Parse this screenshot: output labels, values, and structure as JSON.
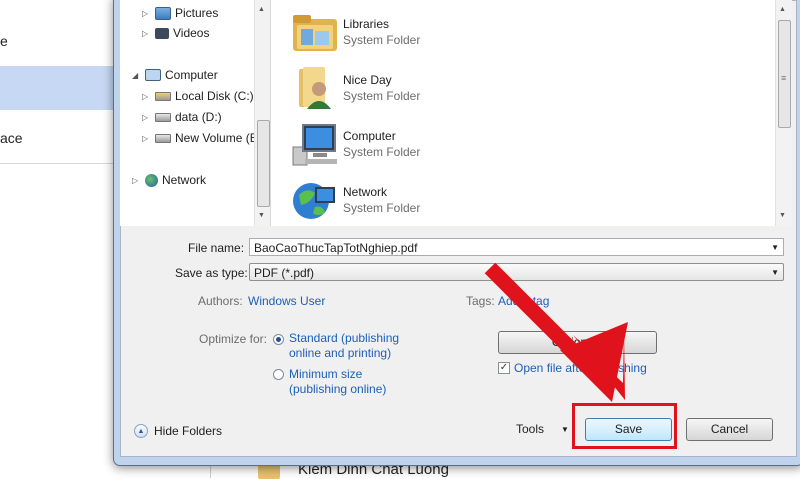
{
  "background": {
    "left_items": [
      "e",
      "ace"
    ],
    "bottom_text": "Kiem Dinh Chat Luong"
  },
  "nav_tree": [
    {
      "label": "Pictures",
      "icon": "pictures-icon",
      "expander": "▷"
    },
    {
      "label": "Videos",
      "icon": "videos-icon",
      "expander": "▷"
    },
    {
      "label": "Computer",
      "icon": "computer-icon",
      "expander": "◢"
    },
    {
      "label": "Local Disk (C:)",
      "icon": "windows-drive-icon",
      "expander": "▷"
    },
    {
      "label": "data (D:)",
      "icon": "drive-icon",
      "expander": "▷"
    },
    {
      "label": "New Volume (E",
      "icon": "drive-icon",
      "expander": "▷"
    },
    {
      "label": "Network",
      "icon": "network-icon",
      "expander": "▷"
    }
  ],
  "files": [
    {
      "name": "Libraries",
      "type": "System Folder",
      "icon": "libraries-folder-icon"
    },
    {
      "name": "Nice Day",
      "type": "System Folder",
      "icon": "user-folder-icon"
    },
    {
      "name": "Computer",
      "type": "System Folder",
      "icon": "computer-icon"
    },
    {
      "name": "Network",
      "type": "System Folder",
      "icon": "network-globe-icon"
    }
  ],
  "form": {
    "file_name_label": "File name:",
    "file_name_value": "BaoCaoThucTapTotNghiep.pdf",
    "save_as_type_label": "Save as type:",
    "save_as_type_value": "PDF (*.pdf)",
    "authors_label": "Authors:",
    "authors_value": "Windows User",
    "tags_label": "Tags:",
    "tags_value": "Add a tag",
    "optimize_label": "Optimize for:",
    "optimize_standard_line1": "Standard (publishing",
    "optimize_standard_line2": "online and printing)",
    "optimize_minimum_line1": "Minimum size",
    "optimize_minimum_line2": "(publishing online)",
    "options_button": "Options...",
    "open_after_label": "Open file after publishing",
    "open_after_checked": true,
    "optimize_selected": "standard"
  },
  "footer": {
    "hide_folders": "Hide Folders",
    "tools": "Tools",
    "save": "Save",
    "cancel": "Cancel"
  },
  "annotation": {
    "highlight_color": "#e0121b",
    "arrow_color": "#e0121b"
  }
}
